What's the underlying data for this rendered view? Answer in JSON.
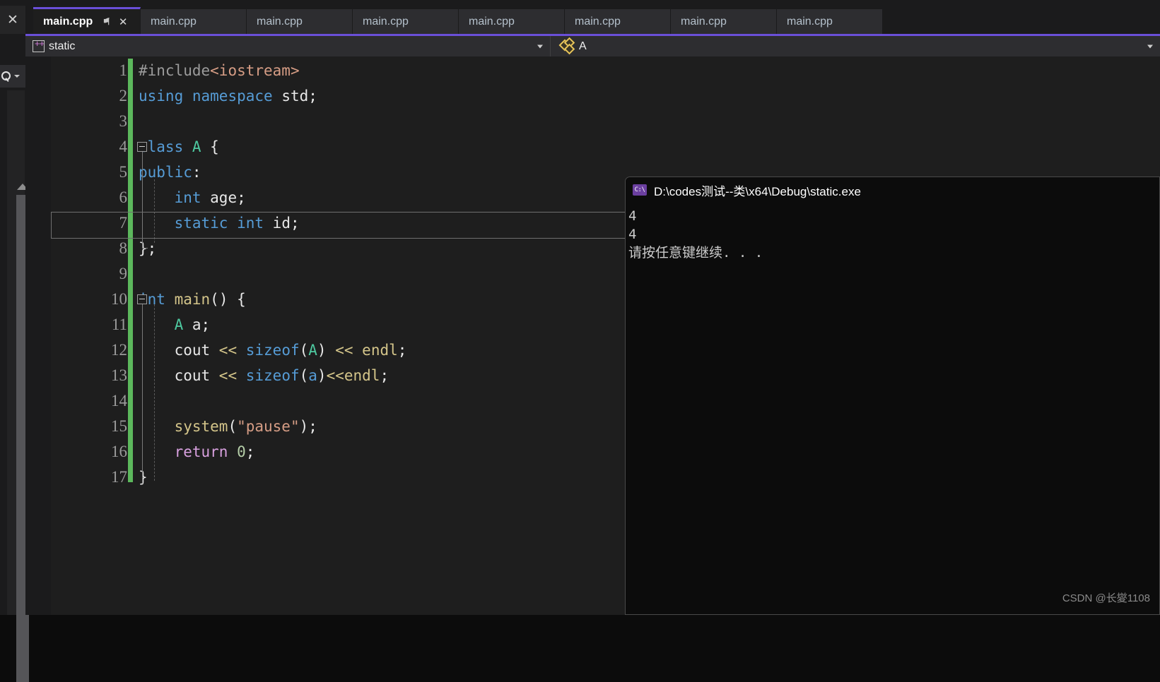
{
  "window": {
    "left_strip": {
      "close_label": "✕",
      "search_icon": "search-icon",
      "search_dropdown": "chevron-down-icon"
    }
  },
  "tabs": [
    {
      "label": "main.cpp",
      "active": true,
      "pin": "⚑",
      "close": "✕"
    },
    {
      "label": "main.cpp",
      "active": false
    },
    {
      "label": "main.cpp",
      "active": false
    },
    {
      "label": "main.cpp",
      "active": false
    },
    {
      "label": "main.cpp",
      "active": false
    },
    {
      "label": "main.cpp",
      "active": false
    },
    {
      "label": "main.cpp",
      "active": false
    },
    {
      "label": "main.cpp",
      "active": false
    }
  ],
  "navbar": {
    "project_label": "static",
    "project_icon": "cpp-project-icon",
    "member_label": "A",
    "member_icon": "class-icon",
    "dropdown_icon": "chevron-down-icon"
  },
  "editor": {
    "line_numbers": [
      "1",
      "2",
      "3",
      "4",
      "5",
      "6",
      "7",
      "8",
      "9",
      "10",
      "11",
      "12",
      "13",
      "14",
      "15",
      "16",
      "17"
    ],
    "current_line": 7,
    "code_lines": [
      "#include<iostream>",
      "using namespace std;",
      "",
      "class A {",
      "public:",
      "    int age;",
      "    static int id;",
      "};",
      "",
      "int main() {",
      "    A a;",
      "    cout << sizeof(A) << endl;",
      "    cout << sizeof(a)<<endl;",
      "",
      "    system(\"pause\");",
      "    return 0;",
      "}"
    ]
  },
  "console": {
    "title": "D:\\codes测试--类\\x64\\Debug\\static.exe",
    "icon_text": "C:\\",
    "output": [
      "4",
      "4",
      "请按任意键继续. . ."
    ]
  },
  "watermark": {
    "text": "CSDN @长夑1108"
  },
  "colors": {
    "accent": "#6a4fd8",
    "editor_bg": "#1e1e1e",
    "chrome_bg": "#2d2d30",
    "console_bg": "#0c0c0c",
    "change_bar": "#5cb85c",
    "keyword": "#569cd6",
    "string": "#d69d85",
    "classname": "#4ec9a0",
    "operator": "#d4c58a"
  }
}
